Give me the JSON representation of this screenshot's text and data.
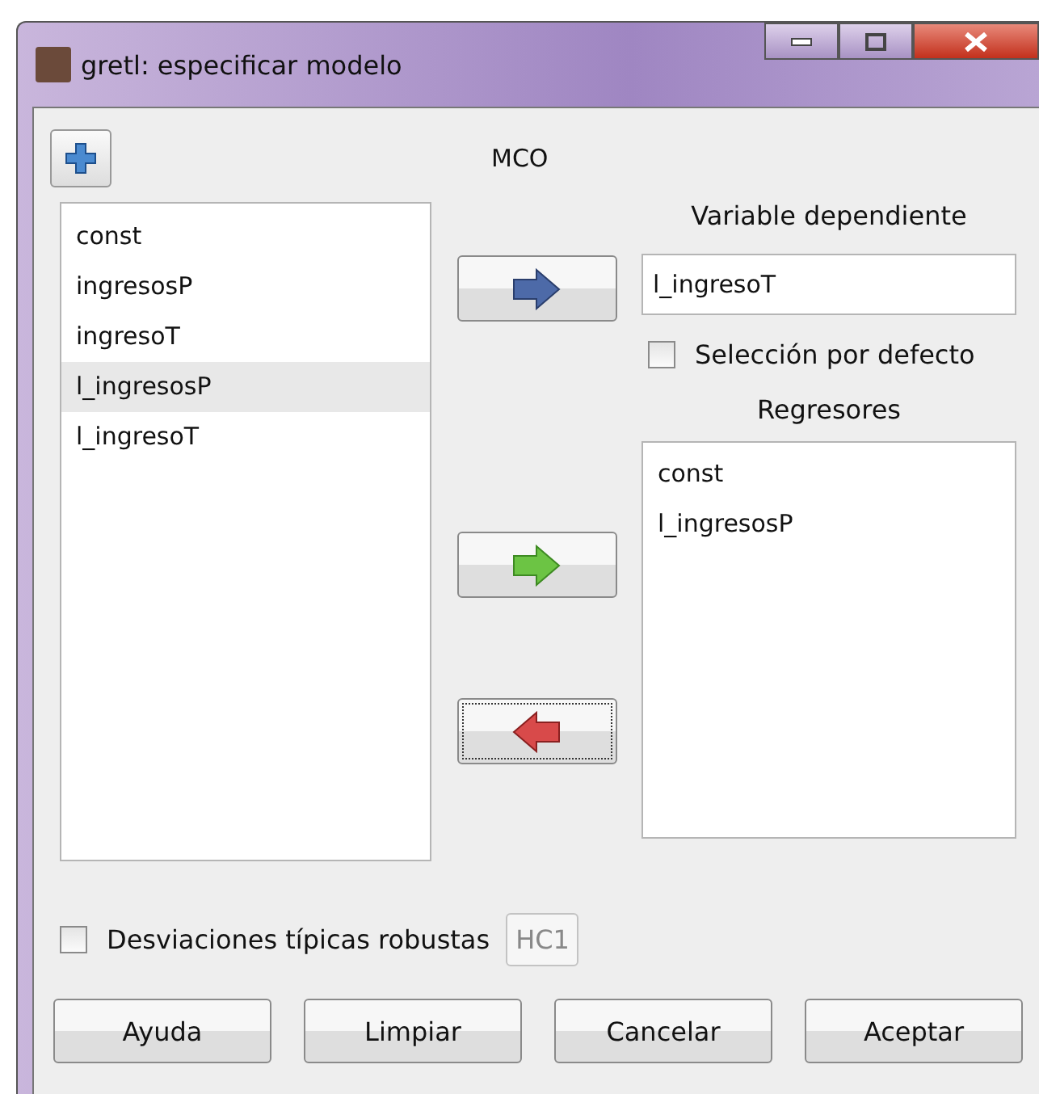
{
  "window": {
    "title": "gretl: especificar modelo"
  },
  "model_label": "MCO",
  "variables": [
    {
      "label": "const",
      "selected": false
    },
    {
      "label": "ingresosP",
      "selected": false
    },
    {
      "label": "ingresoT",
      "selected": false
    },
    {
      "label": "l_ingresosP",
      "selected": true
    },
    {
      "label": "l_ingresoT",
      "selected": false
    }
  ],
  "dependent": {
    "label": "Variable dependiente",
    "value": "l_ingresoT"
  },
  "default_selection": {
    "label": "Selección por defecto",
    "checked": false
  },
  "regressors": {
    "label": "Regresores",
    "items": [
      "const",
      "l_ingresosP"
    ]
  },
  "arrow_buttons": [
    {
      "kind": "right-blue",
      "focused": false
    },
    {
      "kind": "right-green",
      "focused": false
    },
    {
      "kind": "left-red",
      "focused": true
    }
  ],
  "robust": {
    "label": "Desviaciones típicas robustas",
    "checked": false,
    "variant": "HC1"
  },
  "buttons": [
    "Ayuda",
    "Limpiar",
    "Cancelar",
    "Aceptar"
  ]
}
